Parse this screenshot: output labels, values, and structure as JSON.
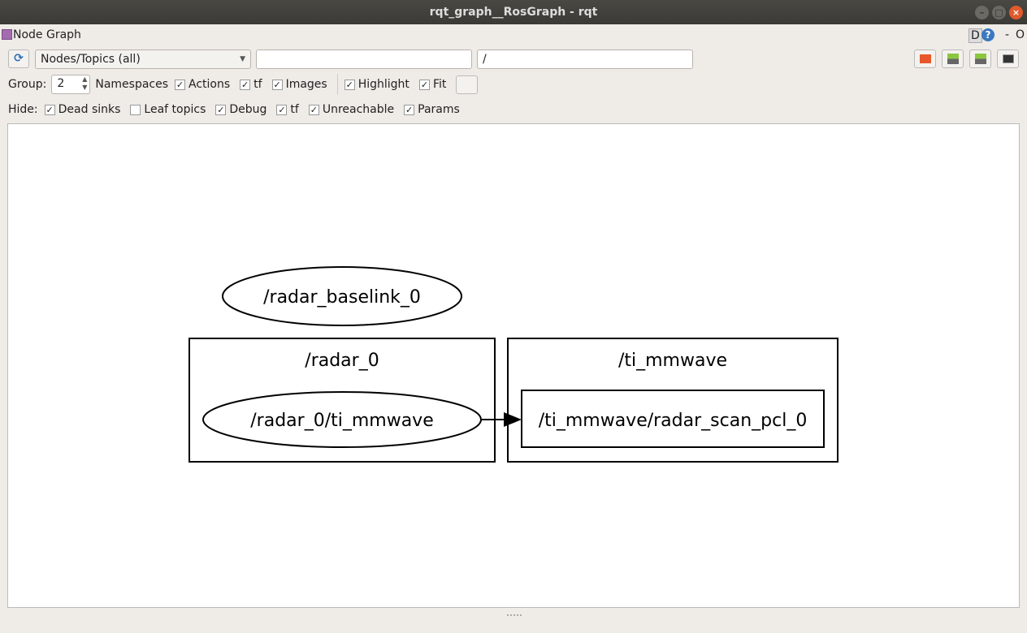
{
  "window": {
    "title": "rqt_graph__RosGraph - rqt"
  },
  "plugin": {
    "title": "Node Graph",
    "d_label": "D",
    "help": "?",
    "dash": "-",
    "o": "O"
  },
  "toolbar": {
    "mode": "Nodes/Topics (all)",
    "filter1": "",
    "filter2": "/"
  },
  "options": {
    "group_label": "Group:",
    "group_value": "2",
    "items": [
      {
        "label": "Namespaces",
        "checked": null
      },
      {
        "label": "Actions",
        "checked": true
      },
      {
        "label": "tf",
        "checked": true
      },
      {
        "label": "Images",
        "checked": true
      },
      {
        "label": "Highlight",
        "checked": true
      },
      {
        "label": "Fit",
        "checked": true
      }
    ]
  },
  "hide": {
    "label": "Hide:",
    "items": [
      {
        "label": "Dead sinks",
        "checked": true
      },
      {
        "label": "Leaf topics",
        "checked": false
      },
      {
        "label": "Debug",
        "checked": true
      },
      {
        "label": "tf",
        "checked": true
      },
      {
        "label": "Unreachable",
        "checked": true
      },
      {
        "label": "Params",
        "checked": true
      }
    ]
  },
  "graph": {
    "node_baselink": "/radar_baselink_0",
    "ns_radar": "/radar_0",
    "node_mmwave": "/radar_0/ti_mmwave",
    "ns_ti": "/ti_mmwave",
    "topic": "/ti_mmwave/radar_scan_pcl_0"
  }
}
